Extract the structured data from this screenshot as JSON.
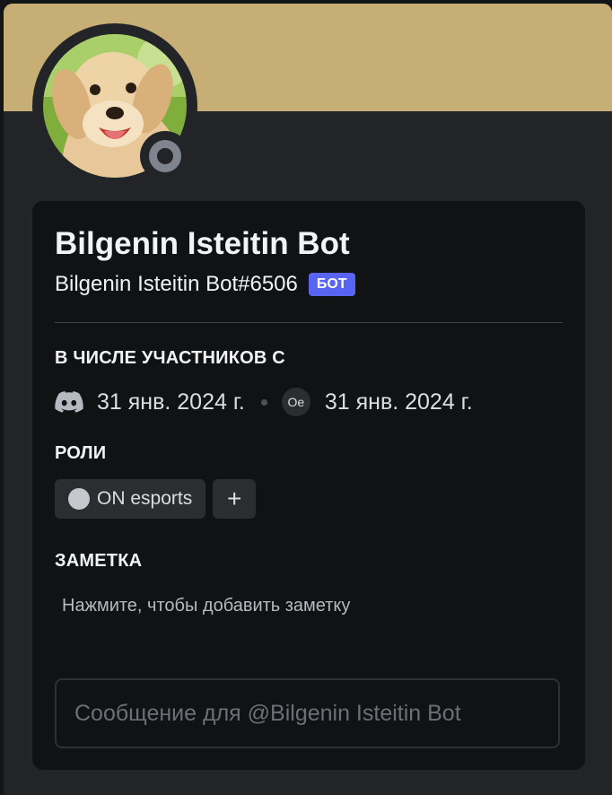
{
  "profile": {
    "display_name": "Bilgenin Isteitin Bot",
    "username": "Bilgenin Isteitin Bot#6506",
    "badge": "БОТ",
    "banner_color": "#c6ae74",
    "status": "offline"
  },
  "member_since": {
    "title": "В ЧИСЛЕ УЧАСТНИКОВ С",
    "discord_icon": "discord-icon",
    "discord_date": "31 янв. 2024 г.",
    "server_icon_label": "Oe",
    "server_date": "31 янв. 2024 г."
  },
  "roles": {
    "title": "РОЛИ",
    "items": [
      {
        "name": "ON esports",
        "color": "#c4c9ce"
      }
    ],
    "add_label": "+"
  },
  "note": {
    "title": "ЗАМЕТКА",
    "placeholder": "Нажмите, чтобы добавить заметку"
  },
  "message": {
    "placeholder": "Сообщение для @Bilgenin Isteitin Bot"
  }
}
